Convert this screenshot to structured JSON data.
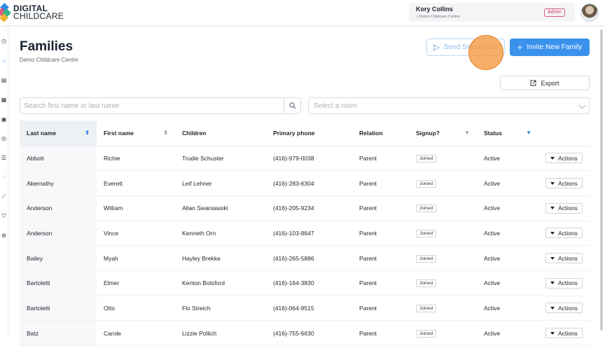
{
  "brand": {
    "line1": "DIGITAL",
    "line2": "CHILDCARE"
  },
  "user": {
    "name": "Kory Collins",
    "centre": "⌂ Demo Childcare Centre",
    "role": "Admin"
  },
  "sidebar": {
    "icons": [
      "dashboard-icon",
      "home-icon",
      "book-icon",
      "document-icon",
      "calendar-icon",
      "money-icon",
      "list-icon",
      "chat-icon",
      "chart-icon",
      "shield-icon",
      "gear-icon"
    ],
    "active": "home-icon"
  },
  "page": {
    "title": "Families",
    "subtitle": "Demo Childcare Centre"
  },
  "buttons": {
    "send_signup": "Send Signup Link",
    "invite": "Invite New Family",
    "export": "Export"
  },
  "filters": {
    "search_placeholder": "Search first name or last name",
    "room_placeholder": "Select a room"
  },
  "table": {
    "headers": [
      "Last name",
      "First name",
      "Children",
      "Primary phone",
      "Relation",
      "Signup?",
      "Status",
      ""
    ],
    "action_label": "Actions",
    "rows": [
      {
        "last": "Abbott",
        "first": "Richie",
        "children": "Trudie Schuster",
        "phone": "(416)-979-0038",
        "relation": "Parent",
        "signup": "Joined",
        "status": "Active"
      },
      {
        "last": "Abernathy",
        "first": "Everett",
        "children": "Leif Lehner",
        "phone": "(416)-283-6304",
        "relation": "Parent",
        "signup": "Joined",
        "status": "Active"
      },
      {
        "last": "Anderson",
        "first": "William",
        "children": "Allan Swaniawski",
        "phone": "(416)-205-9234",
        "relation": "Parent",
        "signup": "Joined",
        "status": "Active"
      },
      {
        "last": "Anderson",
        "first": "Vince",
        "children": "Kenneth Orn",
        "phone": "(416)-103-8647",
        "relation": "Parent",
        "signup": "Joined",
        "status": "Active"
      },
      {
        "last": "Bailey",
        "first": "Myah",
        "children": "Hayley Brekke",
        "phone": "(416)-265-5886",
        "relation": "Parent",
        "signup": "Joined",
        "status": "Active"
      },
      {
        "last": "Bartoletti",
        "first": "Elmer",
        "children": "Kenton Botsford",
        "phone": "(416)-164-3830",
        "relation": "Parent",
        "signup": "Joined",
        "status": "Active"
      },
      {
        "last": "Bartoletti",
        "first": "Otto",
        "children": "Flo Streich",
        "phone": "(416)-064-9515",
        "relation": "Parent",
        "signup": "Joined",
        "status": "Active"
      },
      {
        "last": "Batz",
        "first": "Carole",
        "children": "Lizzie Pollich",
        "phone": "(416)-755-6630",
        "relation": "Parent",
        "signup": "Joined",
        "status": "Active"
      }
    ]
  },
  "colors": {
    "primary": "#3a92ec",
    "admin": "#d0356a",
    "highlight": "#f5983c"
  }
}
